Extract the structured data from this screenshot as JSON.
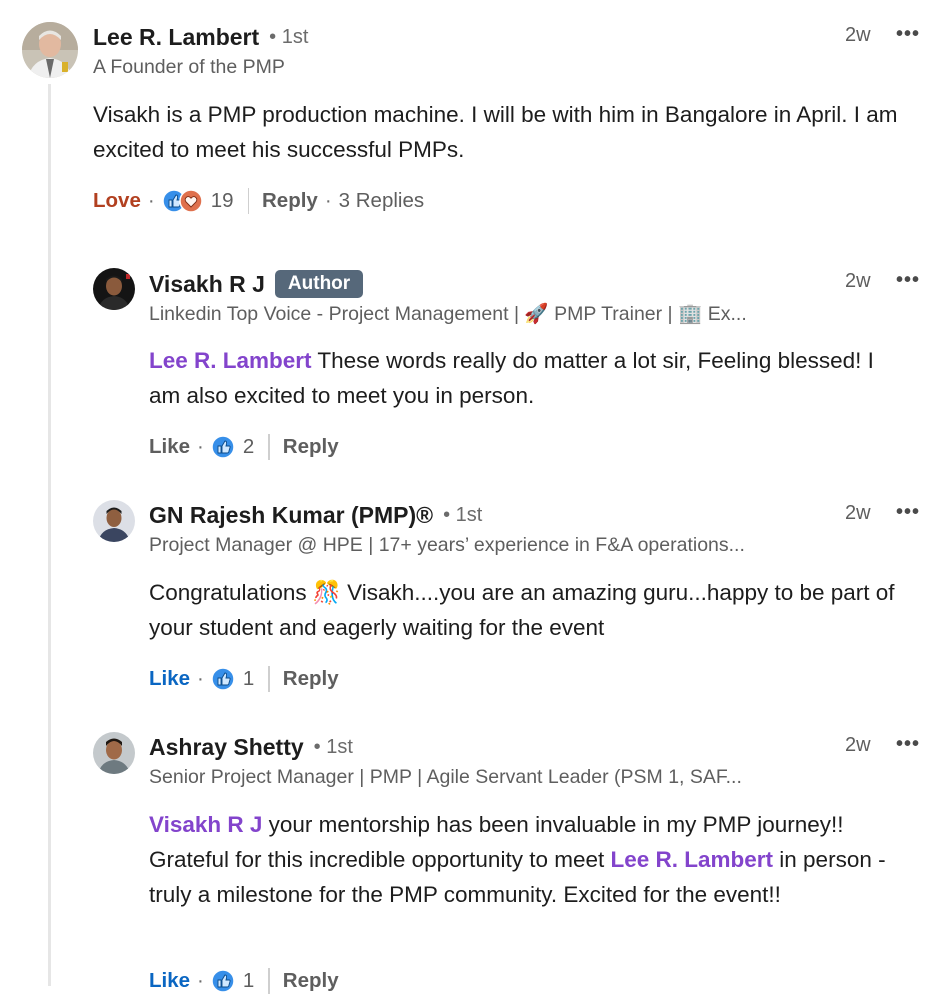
{
  "comments": [
    {
      "name": "Lee R. Lambert",
      "degree": "• 1st",
      "headline": "A Founder of the PMP",
      "time": "2w",
      "more": "•••",
      "body": "Visakh is a PMP production machine. I will be with him in Bangalore in April. I am excited to meet his successful PMPs.",
      "reaction_label": "Love",
      "separator": "·",
      "reaction_count": "19",
      "reply_label": "Reply",
      "replies_count": "3 Replies"
    },
    {
      "name": "Visakh R J",
      "badge": "Author",
      "headline": "Linkedin Top Voice - Project Management | 🚀 PMP Trainer | 🏢 Ex...",
      "time": "2w",
      "more": "•••",
      "mention": "Lee R. Lambert",
      "body": " These words really do matter a lot sir, Feeling blessed! I am also excited to meet you in person.",
      "reaction_label": "Like",
      "separator": "·",
      "reaction_count": "2",
      "reply_label": "Reply"
    },
    {
      "name": "GN Rajesh Kumar (PMP)®",
      "degree": "• 1st",
      "headline": "Project Manager @ HPE | 17+ years’ experience in F&A operations...",
      "time": "2w",
      "more": "•••",
      "body_pre": "Congratulations ",
      "body_emoji": "🎊",
      "body": " Visakh....you are an amazing guru...happy to be part of your student and eagerly waiting for the event",
      "reaction_label": "Like",
      "separator": "·",
      "reaction_count": "1",
      "reply_label": "Reply"
    },
    {
      "name": "Ashray Shetty",
      "degree": "• 1st",
      "headline": "Senior Project Manager | PMP | Agile Servant Leader (PSM 1, SAF...",
      "time": "2w",
      "more": "•••",
      "mention": "Visakh R J",
      "body_a": " your mentorship has been invaluable in my PMP journey!! Grateful for this incredible opportunity to meet ",
      "mention2": "Lee R. Lambert",
      "body_b": " in person - truly a milestone for the PMP community. Excited for the event!!",
      "reaction_label": "Like",
      "separator": "·",
      "reaction_count": "1",
      "reply_label": "Reply"
    }
  ],
  "colors": {
    "mention": "#8344cc",
    "love": "#b24020",
    "liked": "#0a66c2",
    "like_icon": "#378fe9",
    "love_icon": "#df704d",
    "author_badge": "#56687a"
  },
  "icons": [
    "like-icon",
    "love-icon",
    "more-options-icon"
  ]
}
